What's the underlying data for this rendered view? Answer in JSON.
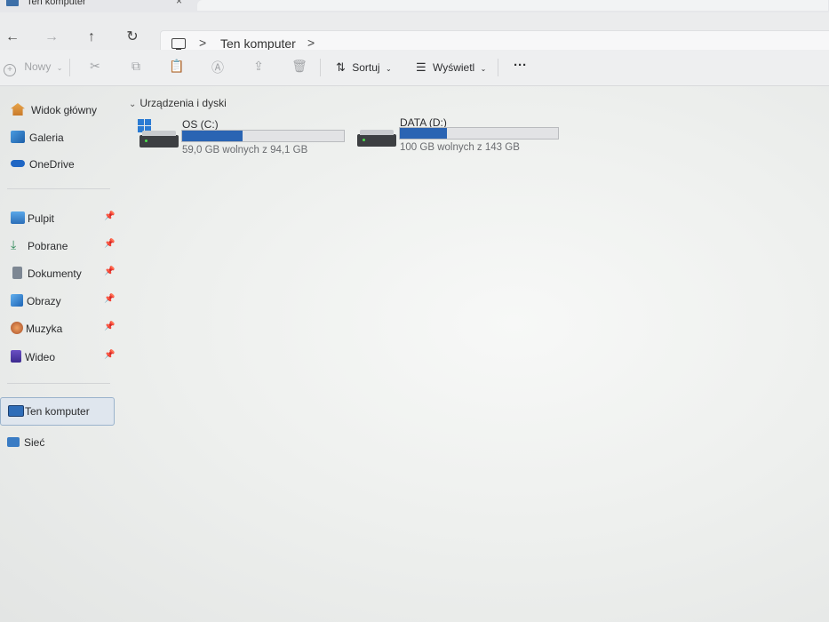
{
  "window": {
    "title": "Ten komputer"
  },
  "nav": {
    "back": "←",
    "forward": "→",
    "up": "↑",
    "refresh": "↻"
  },
  "address": {
    "separator": ">",
    "location": "Ten komputer",
    "trailing_separator": ">"
  },
  "toolbar": {
    "new_label": "Nowy",
    "sort_label": "Sortuj",
    "view_label": "Wyświetl",
    "more_label": "···",
    "icons": [
      "cut-icon",
      "copy-icon",
      "paste-icon",
      "rename-icon",
      "share-icon",
      "delete-icon"
    ]
  },
  "sidebar": {
    "items": [
      {
        "label": "Widok główny",
        "icon": "home-icon"
      },
      {
        "label": "Galeria",
        "icon": "gallery-icon"
      },
      {
        "label": "OneDrive",
        "icon": "cloud-icon"
      },
      {
        "label": "Pulpit",
        "icon": "desktop-icon",
        "pinned": true
      },
      {
        "label": "Pobrane",
        "icon": "download-icon",
        "pinned": true
      },
      {
        "label": "Dokumenty",
        "icon": "document-icon",
        "pinned": true
      },
      {
        "label": "Obrazy",
        "icon": "pictures-icon",
        "pinned": true
      },
      {
        "label": "Muzyka",
        "icon": "music-icon",
        "pinned": true
      },
      {
        "label": "Wideo",
        "icon": "video-icon",
        "pinned": true
      },
      {
        "label": "Ten komputer",
        "icon": "computer-icon",
        "selected": true
      },
      {
        "label": "Sieć",
        "icon": "network-icon"
      }
    ]
  },
  "content": {
    "group_label": "Urządzenia i dyski",
    "drives": [
      {
        "name": "OS (C:)",
        "free_text": "59,0 GB wolnych z 94,1 GB",
        "used_fraction": 0.373
      },
      {
        "name": "DATA (D:)",
        "free_text": "100 GB wolnych z 143 GB",
        "used_fraction": 0.3
      }
    ]
  },
  "colors": {
    "usage_bar": "#2a64b3",
    "selection_border": "#9ab3cc",
    "selection_bg": "#dfe6ee"
  }
}
